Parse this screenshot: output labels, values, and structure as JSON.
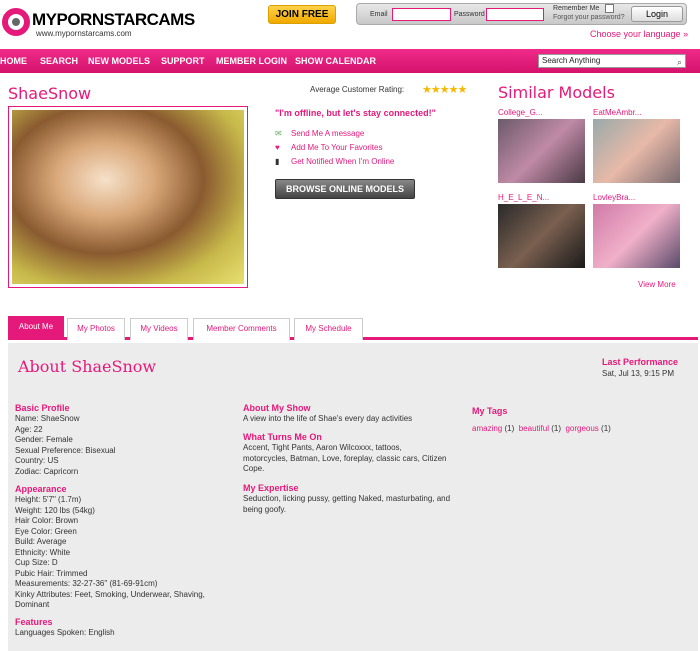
{
  "header": {
    "brand": "MYPORNSTARCAMS",
    "url": "www.mypornstarcams.com",
    "join_label": "JOIN FREE",
    "email_label": "Email",
    "password_label": "Password",
    "remember_label": "Remember Me",
    "forgot_label": "Forgot your password?",
    "login_label": "Login",
    "language_label": "Choose your language »"
  },
  "nav": {
    "items": [
      "HOME",
      "SEARCH",
      "NEW MODELS",
      "SUPPORT",
      "MEMBER LOGIN",
      "SHOW CALENDAR"
    ],
    "search_value": "Search Anything"
  },
  "profile": {
    "name": "ShaeSnow",
    "rating_label": "Average Customer Rating:",
    "rating_stars": 5,
    "offline_text": "\"I'm offline, but let's stay connected!\"",
    "actions": [
      "Send Me A message",
      "Add Me To Your Favorites",
      "Get Notified When I'm Online"
    ],
    "browse_label": "BROWSE ONLINE MODELS"
  },
  "similar": {
    "title": "Similar Models",
    "models": [
      "College_G...",
      "EatMeAmbr...",
      "H_E_L_E_N...",
      "LovleyBra..."
    ],
    "view_more": "View More"
  },
  "tabs": [
    "About Me",
    "My Photos",
    "My Videos",
    "Member Comments",
    "My Schedule"
  ],
  "about": {
    "title": "About ShaeSnow",
    "last_performance_label": "Last Performance",
    "last_performance_value": "Sat, Jul 13, 9:15 PM",
    "basic_profile_heading": "Basic Profile",
    "basic_profile": [
      "Name: ShaeSnow",
      "Age: 22",
      "Gender: Female",
      "Sexual Preference: Bisexual",
      "Country: US",
      "Zodiac: Capricorn"
    ],
    "appearance_heading": "Appearance",
    "appearance": [
      "Height: 5'7\" (1.7m)",
      "Weight: 120 lbs (54kg)",
      "Hair Color: Brown",
      "Eye Color: Green",
      "Build: Average",
      "Ethnicity: White",
      "Cup Size: D",
      "Pubic Hair: Trimmed",
      "Measurements: 32-27-36\" (81-69-91cm)",
      "Kinky Attributes: Feet, Smoking, Underwear, Shaving,",
      "Dominant"
    ],
    "features_heading": "Features",
    "features": [
      "Languages Spoken: English"
    ],
    "about_show_heading": "About My Show",
    "about_show": "A view into the life of Shae's every day activities",
    "turns_me_on_heading": "What Turns Me On",
    "turns_me_on": "Accent, Tight Pants, Aaron Wilcoxxx, tattoos, motorcycles, Batman, Love, foreplay, classic cars, Citizen Cope.",
    "expertise_heading": "My Expertise",
    "expertise": "Seduction, licking pussy, getting Naked, masturbating, and being goofy.",
    "tags_heading": "My Tags",
    "tags": [
      {
        "tag": "amazing",
        "count": "(1)"
      },
      {
        "tag": "beautiful",
        "count": "(1)"
      },
      {
        "tag": "gorgeous",
        "count": "(1)"
      }
    ]
  }
}
